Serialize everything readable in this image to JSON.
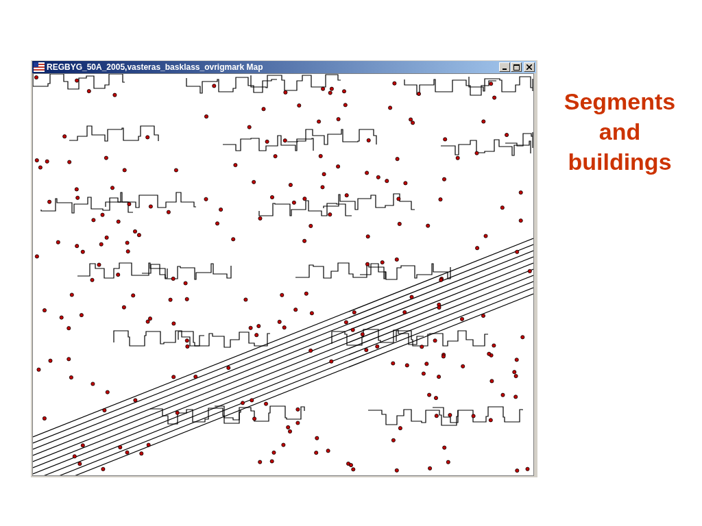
{
  "window": {
    "title": "REGBYG_50A_2005,vasteras_basklass_ovrigmark Map"
  },
  "slide_title": "Segments and buildings"
}
